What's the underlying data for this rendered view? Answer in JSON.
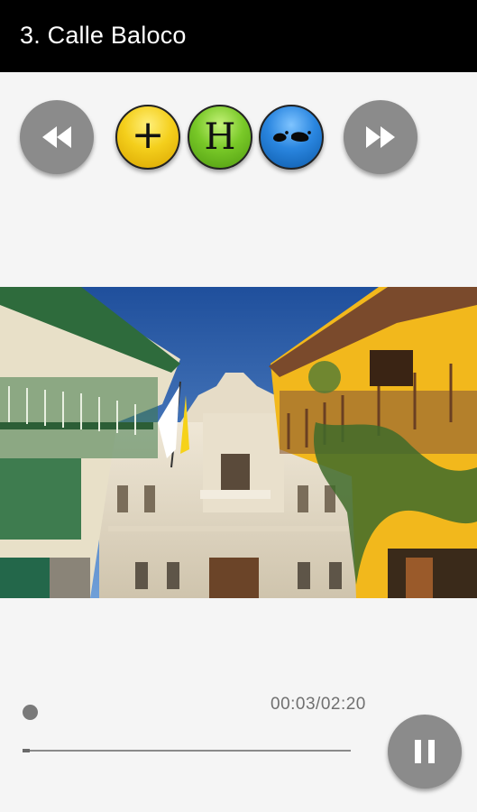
{
  "header": {
    "title": "3. Calle Baloco"
  },
  "toolbar": {
    "rewind_icon": "rewind-icon",
    "forward_icon": "fast-forward-icon",
    "modes": [
      {
        "name": "add",
        "glyph": "+",
        "color": "#f2c81a"
      },
      {
        "name": "history",
        "glyph": "H",
        "color": "#6fc21f"
      },
      {
        "name": "walk",
        "glyph": "footprints-icon",
        "color": "#1f7ad6"
      }
    ]
  },
  "photo": {
    "icon": "street-photo"
  },
  "player": {
    "time_display": "00:03/02:20",
    "progress_fraction": 0.021,
    "pause_icon": "pause-icon"
  }
}
